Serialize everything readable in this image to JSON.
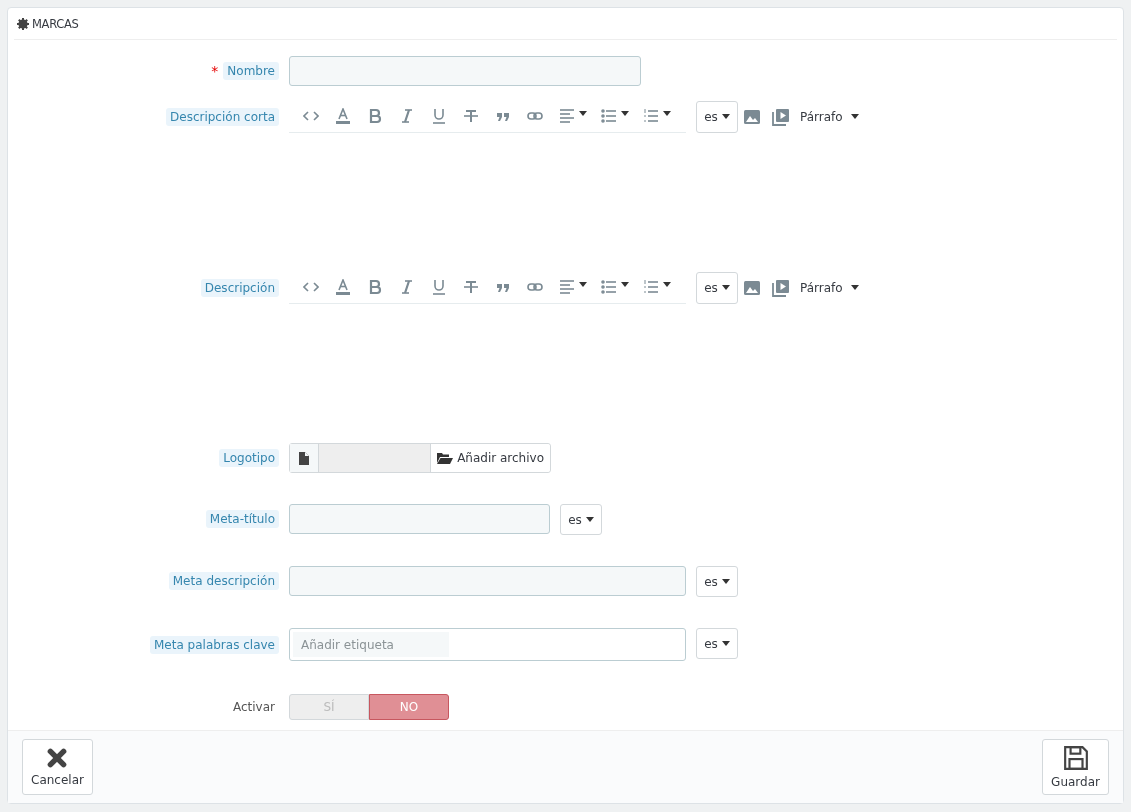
{
  "panel": {
    "title": "MARCAS"
  },
  "fields": [
    {
      "kind": "text",
      "label": "Nombre",
      "required_mark": "*",
      "tooltip": true
    },
    {
      "kind": "editor",
      "label": "Descripción corta",
      "tooltip": true,
      "language": "es",
      "format": "Párrafo"
    },
    {
      "kind": "editor",
      "label": "Descripción",
      "tooltip": true,
      "language": "es",
      "format": "Párrafo"
    },
    {
      "kind": "file",
      "label": "Logotipo",
      "tooltip": true,
      "button": "Añadir archivo"
    },
    {
      "kind": "short_lang_text",
      "label": "Meta-título",
      "tooltip": true,
      "language": "es"
    },
    {
      "kind": "long_lang_text",
      "label": "Meta descripción",
      "tooltip": true,
      "language": "es"
    },
    {
      "kind": "tags",
      "label": "Meta palabras clave",
      "tooltip": true,
      "placeholder": "Añadir etiqueta",
      "language": "es"
    },
    {
      "kind": "switch",
      "label": "Activar",
      "tooltip": false,
      "options": [
        {
          "label": "SÍ",
          "selected": false
        },
        {
          "label": "NO",
          "selected": true
        }
      ]
    }
  ],
  "footer": {
    "buttons": [
      {
        "kind": "cancel",
        "label": "Cancelar"
      },
      {
        "kind": "save",
        "label": "Guardar"
      }
    ]
  }
}
